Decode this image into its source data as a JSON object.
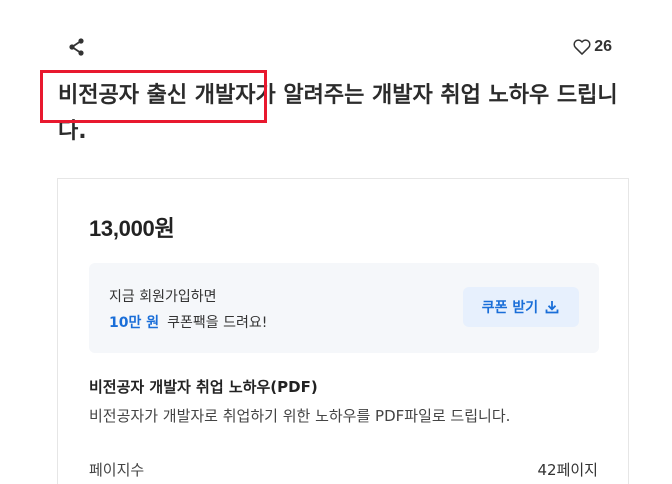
{
  "header": {
    "share_icon": "share-icon",
    "like_icon": "heart-icon",
    "like_count": "26"
  },
  "title": "비전공자 출신 개발자가 알려주는 개발자 취업 노하우 드립니다.",
  "product": {
    "price": "13,000원",
    "coupon": {
      "line1": "지금 회원가입하면",
      "amount": "10만 원",
      "line2_rest": "쿠폰팩을 드려요!",
      "button_label": "쿠폰 받기",
      "button_icon": "download-icon"
    },
    "name": "비전공자 개발자 취업 노하우(PDF)",
    "description": "비전공자가 개발자로 취업하기 위한 노하우를 PDF파일로 드립니다.",
    "meta": {
      "label": "페이지수",
      "value": "42페이지"
    }
  },
  "colors": {
    "accent": "#1a6ed8",
    "highlight": "#e8182e",
    "coupon_bg": "#f5f7fa",
    "coupon_btn_bg": "#e7f0fd"
  }
}
